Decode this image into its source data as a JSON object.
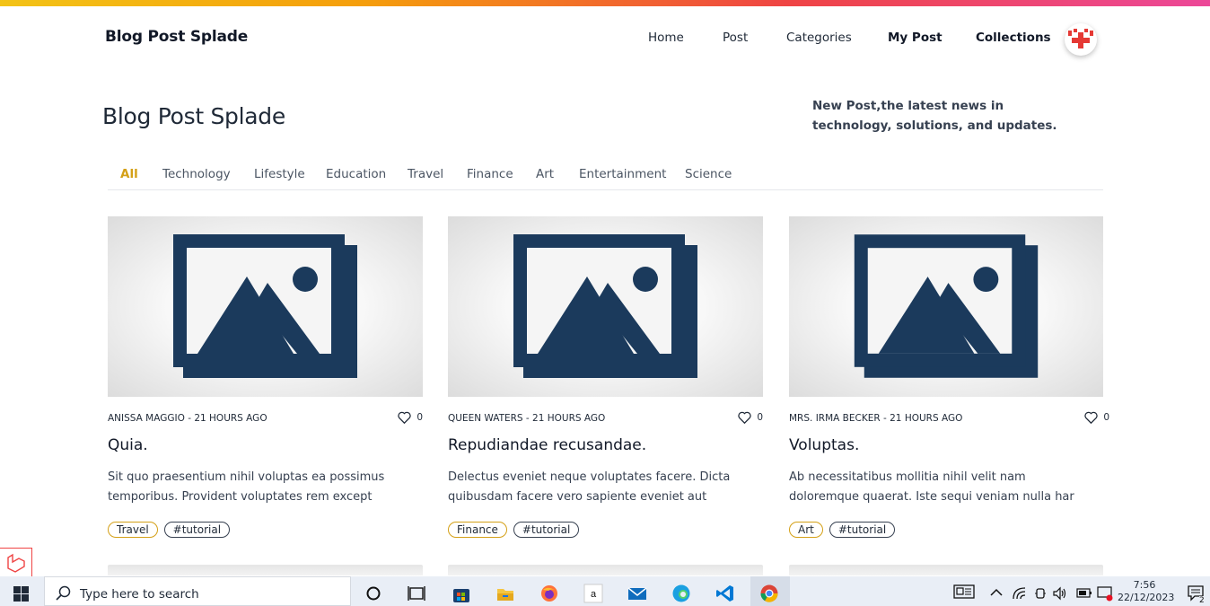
{
  "header": {
    "brand": "Blog Post Splade",
    "nav": [
      {
        "label": "Home"
      },
      {
        "label": "Post"
      },
      {
        "label": "Categories"
      },
      {
        "label": "My Post"
      },
      {
        "label": "Collections"
      }
    ]
  },
  "hero": {
    "title": "Blog Post Splade",
    "description": "New Post,the latest news in technology, solutions, and updates."
  },
  "filters": [
    "All",
    "Technology",
    "Lifestyle",
    "Education",
    "Travel",
    "Finance",
    "Art",
    "Entertainment",
    "Science"
  ],
  "active_filter": "All",
  "cards": [
    {
      "meta": "ANISSA MAGGIO - 21 HOURS AGO",
      "likes": "0",
      "title": "Quia.",
      "excerpt": "Sit quo praesentium nihil voluptas ea possimus temporibus. Provident voluptates rem except",
      "category": "Travel",
      "tag": "#tutorial"
    },
    {
      "meta": "QUEEN WATERS - 21 HOURS AGO",
      "likes": "0",
      "title": "Repudiandae recusandae.",
      "excerpt": "Delectus eveniet neque voluptates facere. Dicta quibusdam facere vero sapiente eveniet aut",
      "category": "Finance",
      "tag": "#tutorial"
    },
    {
      "meta": "MRS. IRMA BECKER - 21 HOURS AGO",
      "likes": "0",
      "title": "Voluptas.",
      "excerpt": "Ab necessitatibus mollitia nihil velit nam doloremque quaerat. Iste sequi veniam nulla har",
      "category": "Art",
      "tag": "#tutorial"
    }
  ],
  "taskbar": {
    "search_placeholder": "Type here to search",
    "time": "7:56",
    "date": "22/12/2023",
    "notifications": "2",
    "apps": [
      "task-view-icon",
      "microsoft-store-icon",
      "file-explorer-icon",
      "firefox-icon",
      "amazon-icon",
      "mail-icon",
      "edge-icon",
      "vscode-icon",
      "chrome-icon"
    ]
  },
  "colors": {
    "accent": "#d4a017",
    "image_placeholder": "#1b3a5c",
    "avatar_mark": "#e53935"
  }
}
